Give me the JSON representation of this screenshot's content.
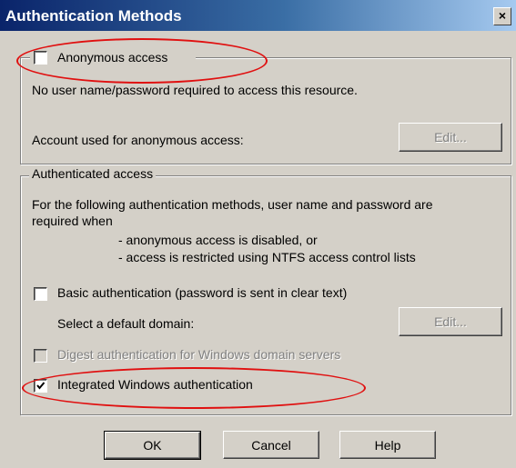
{
  "window": {
    "title": "Authentication Methods",
    "close_glyph": "×"
  },
  "anonymous": {
    "label": "Anonymous access",
    "checked": false,
    "description": "No user name/password required to access this resource.",
    "account_label": "Account used for anonymous access:",
    "edit_label": "Edit..."
  },
  "authenticated": {
    "legend": "Authenticated access",
    "intro_line1": "For the following authentication methods, user name and password are",
    "intro_line2": "required when",
    "bullet1": "- anonymous access is disabled, or",
    "bullet2": "- access is restricted using NTFS access control lists",
    "basic_label": "Basic authentication (password is sent in clear text)",
    "basic_checked": false,
    "domain_label": "Select a default domain:",
    "edit_label": "Edit...",
    "digest_label": "Digest authentication for Windows domain servers",
    "digest_checked": false,
    "integrated_label": "Integrated Windows authentication",
    "integrated_checked": true
  },
  "buttons": {
    "ok": "OK",
    "cancel": "Cancel",
    "help": "Help"
  },
  "colors": {
    "dialog_bg": "#d4d0c8",
    "title_bar": "#0a246a",
    "annotation": "#e01010"
  }
}
